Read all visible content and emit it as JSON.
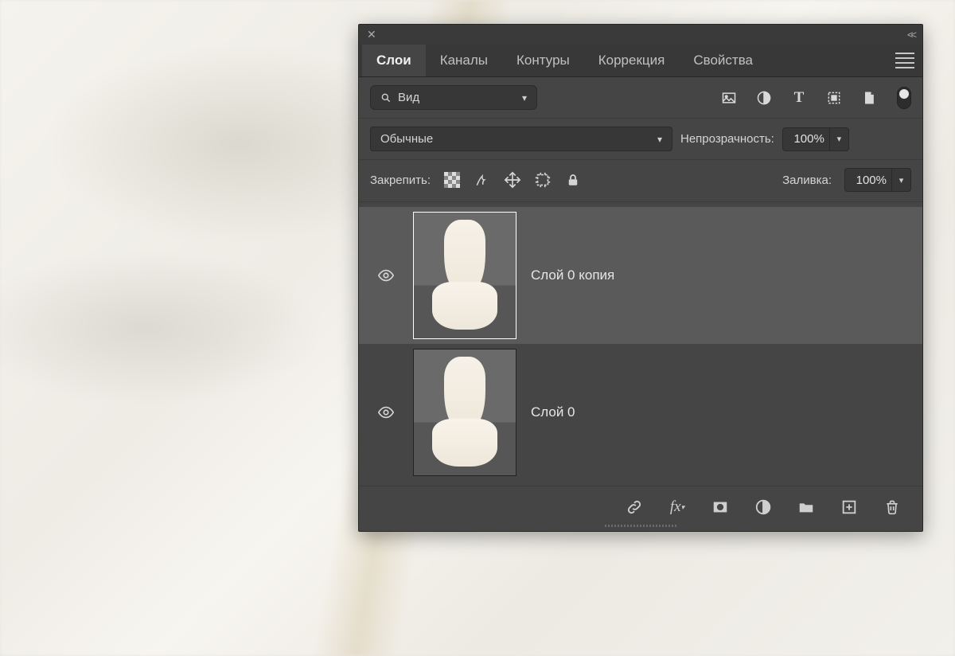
{
  "tabs": {
    "layers": "Слои",
    "channels": "Каналы",
    "paths": "Контуры",
    "adjustments": "Коррекция",
    "properties": "Свойства"
  },
  "active_tab": "layers",
  "filter": {
    "kind_label": "Вид"
  },
  "blend": {
    "mode": "Обычные",
    "opacity_label": "Непрозрачность:",
    "opacity_value": "100%"
  },
  "lock": {
    "label": "Закрепить:",
    "fill_label": "Заливка:",
    "fill_value": "100%"
  },
  "layers": [
    {
      "name": "Слой 0 копия",
      "visible": true,
      "selected": true
    },
    {
      "name": "Слой 0",
      "visible": true,
      "selected": false
    }
  ]
}
